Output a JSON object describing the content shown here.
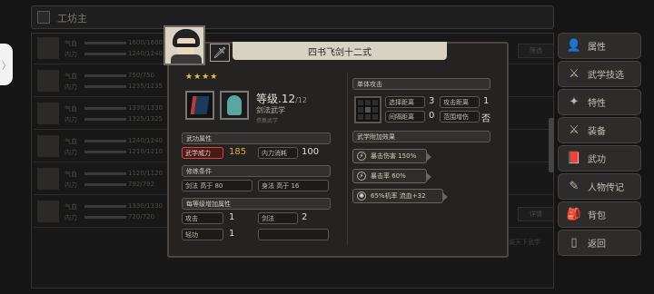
{
  "edge_tab_glyph": "〉",
  "topbar": {
    "title": "工坊主"
  },
  "background_rows": [
    {
      "label1": "气血",
      "label2": "内力",
      "num1": "1600/1600",
      "num2": "1240/1240"
    },
    {
      "label1": "气血",
      "label2": "内力",
      "num1": "750/750",
      "num2": "1235/1235"
    },
    {
      "label1": "气血",
      "label2": "内力",
      "num1": "1330/1330",
      "num2": "1325/1325"
    },
    {
      "label1": "气血",
      "label2": "内力",
      "num1": "1240/1240",
      "num2": "1210/1210"
    },
    {
      "label1": "气血",
      "label2": "内力",
      "num1": "1120/1120",
      "num2": "792/792"
    },
    {
      "label1": "气血",
      "label2": "内力",
      "num1": "1330/1330",
      "num2": "720/720"
    }
  ],
  "ghost_buttons": {
    "top": "筛选",
    "mid": "详情",
    "bottom": "装天下武学"
  },
  "sidebar": [
    {
      "label": "属性",
      "icon": "profile-icon",
      "glyph": "👤"
    },
    {
      "label": "武学技选",
      "icon": "skill-select-icon",
      "glyph": "⚔"
    },
    {
      "label": "特性",
      "icon": "trait-icon",
      "glyph": "✦"
    },
    {
      "label": "装备",
      "icon": "equipment-icon",
      "glyph": "⚔"
    },
    {
      "label": "武功",
      "icon": "martial-arts-icon",
      "glyph": "📕"
    },
    {
      "label": "人物传记",
      "icon": "biography-icon",
      "glyph": "✎"
    },
    {
      "label": "背包",
      "icon": "backpack-icon",
      "glyph": "🎒"
    },
    {
      "label": "返回",
      "icon": "return-icon",
      "glyph": "▯"
    }
  ],
  "skill_card": {
    "title": "四书飞剑十二式",
    "stars": "★★★★",
    "level_label": "等级.",
    "level_value": "12",
    "level_max": "/12",
    "type": "剑法武学",
    "subtype": "攒集武学",
    "attr_header": "武功属性",
    "attr_items": [
      {
        "label": "武学威力",
        "value": "185"
      },
      {
        "label": "内力消耗",
        "value": "100"
      }
    ],
    "req_header": "修练条件",
    "req_items": [
      {
        "label": "剑法 高于 80"
      },
      {
        "label": "身法 高于 16"
      }
    ],
    "bonus_header": "每等级增加属性",
    "bonus_items": [
      {
        "label": "攻击",
        "value": "1"
      },
      {
        "label": "剑法",
        "value": "2"
      },
      {
        "label": "轻功",
        "value": "1"
      }
    ],
    "attack_header": "单体攻击",
    "attack_items": [
      {
        "label": "选择距离",
        "value": "3"
      },
      {
        "label": "攻击距离",
        "value": "1"
      },
      {
        "label": "间隔距离",
        "value": "0"
      },
      {
        "label": "范围增伤",
        "value": "否"
      }
    ],
    "effects_header": "武学附加效果",
    "effects": [
      {
        "text": "暴击伤害 150%",
        "icon": "crit-damage-icon"
      },
      {
        "text": "暴击率 60%",
        "icon": "crit-rate-icon"
      },
      {
        "text": "65%机率 流血+32",
        "icon": "bleed-icon"
      }
    ]
  }
}
